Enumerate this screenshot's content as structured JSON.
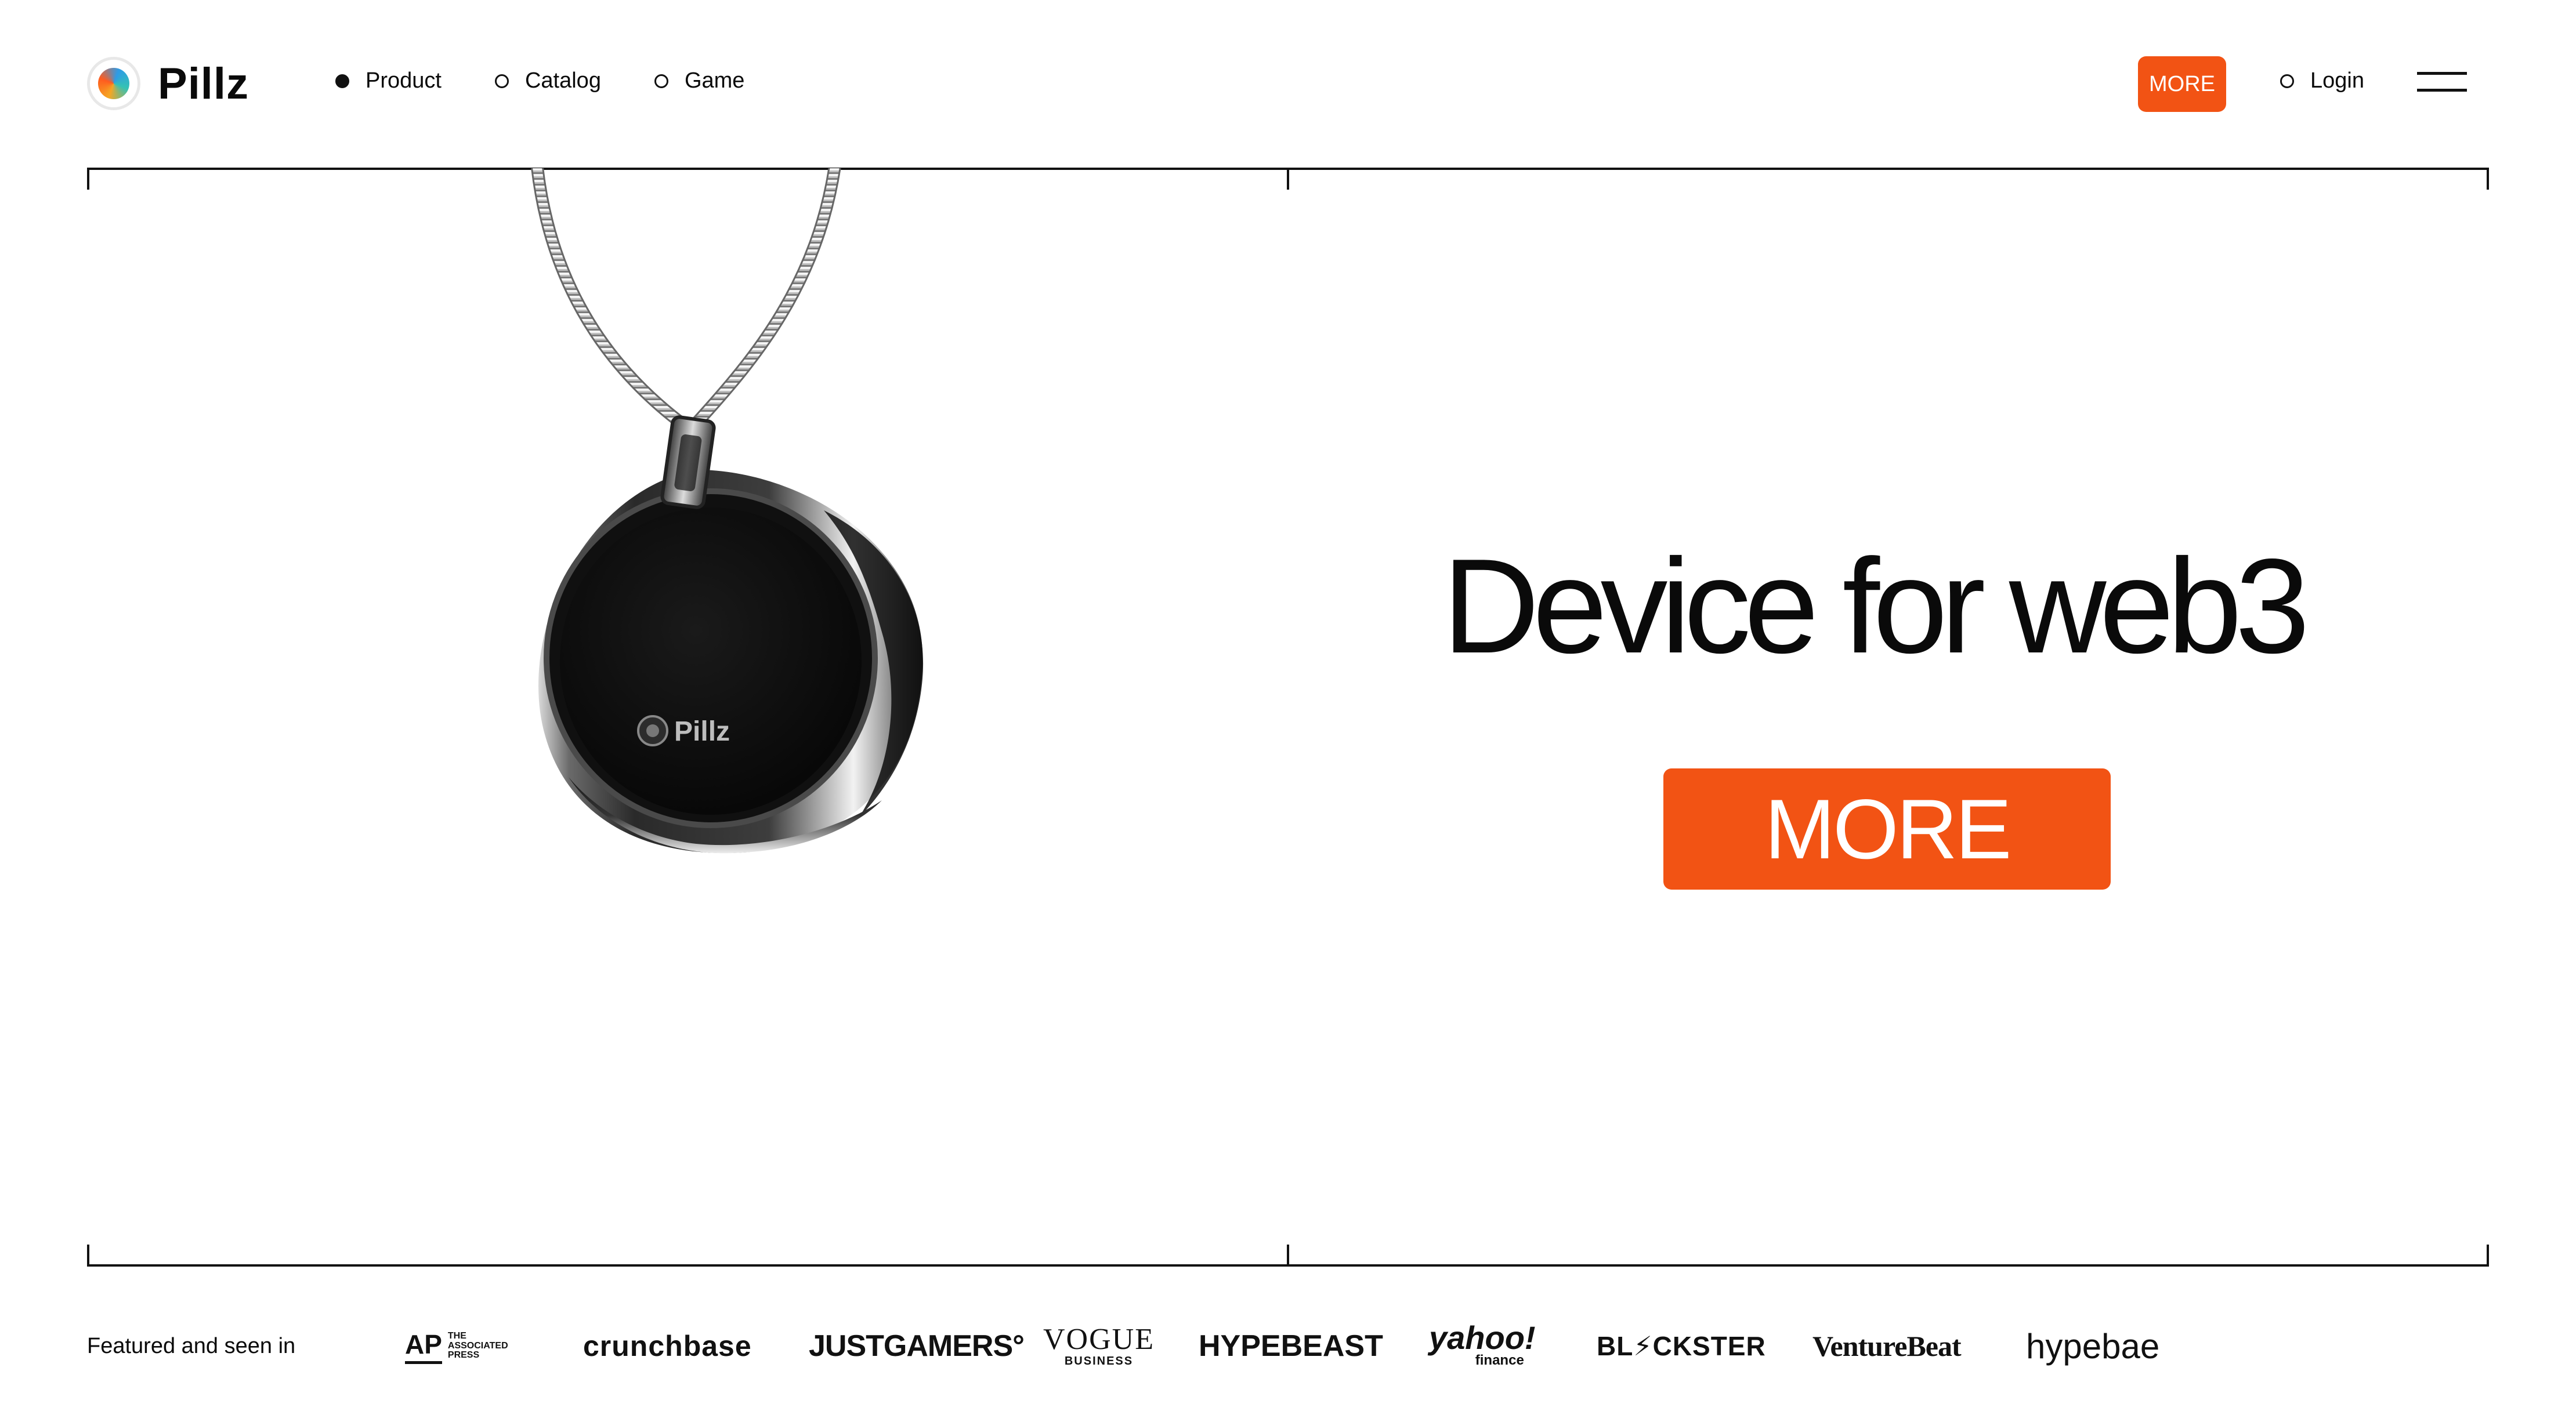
{
  "header": {
    "brand": "Pillz",
    "nav": [
      {
        "label": "Product",
        "active": true
      },
      {
        "label": "Catalog",
        "active": false
      },
      {
        "label": "Game",
        "active": false
      }
    ],
    "cta_label": "MORE",
    "login_label": "Login"
  },
  "hero": {
    "pendant_brand": "Pillz",
    "headline": "Device for web3",
    "cta_label": "MORE"
  },
  "featured": {
    "label": "Featured and seen in",
    "logos": {
      "ap": "AP",
      "ap_sub_1": "THE",
      "ap_sub_2": "ASSOCIATED",
      "ap_sub_3": "PRESS",
      "crunchbase": "crunchbase",
      "justgamers": "JUSTGAMERS°",
      "vogue": "VOGUE",
      "vogue_sub": "BUSINESS",
      "hypebeast": "HYPEBEAST",
      "yahoo": "yahoo!",
      "yahoo_sub": "finance",
      "blockster": "BL⚡CKSTER",
      "venturebeat": "VentureBeat",
      "hypebae": "hypebae"
    }
  },
  "colors": {
    "accent": "#f25314",
    "text": "#0a0a0a",
    "background": "#ffffff"
  }
}
